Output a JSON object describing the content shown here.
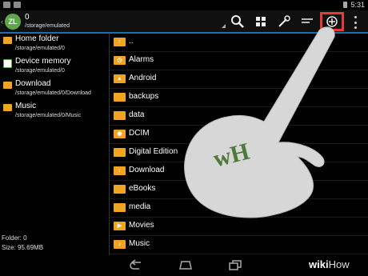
{
  "status_bar": {
    "time": "5:31"
  },
  "action_bar": {
    "app_logo_text": "ZL",
    "current_folder": "0",
    "current_path": "/storage/emulated",
    "icons": [
      "search-icon",
      "grid-view-icon",
      "tools-icon",
      "sort-icon",
      "add-icon",
      "overflow-menu-icon"
    ]
  },
  "sidebar": {
    "items": [
      {
        "label": "Home folder",
        "path": "/storage/emulated/0",
        "icon": "home-folder-icon"
      },
      {
        "label": "Device memory",
        "path": "/storage/emulated/0",
        "icon": "device-memory-icon"
      },
      {
        "label": "Download",
        "path": "/storage/emulated/0/Download",
        "icon": "folder-icon"
      },
      {
        "label": "Music",
        "path": "/storage/emulated/0/Music",
        "icon": "folder-icon"
      }
    ],
    "footer_folder": "Folder: 0",
    "footer_size": "Size: 95.69MB"
  },
  "files": [
    {
      "name": "..",
      "icon": "up-folder-icon"
    },
    {
      "name": "Alarms",
      "icon": "alarm-folder-icon"
    },
    {
      "name": "Android",
      "icon": "android-folder-icon"
    },
    {
      "name": "backups",
      "icon": "folder-icon"
    },
    {
      "name": "data",
      "icon": "folder-icon"
    },
    {
      "name": "DCIM",
      "icon": "camera-folder-icon"
    },
    {
      "name": "Digital Edition",
      "icon": "folder-icon"
    },
    {
      "name": "Download",
      "icon": "download-folder-icon"
    },
    {
      "name": "eBooks",
      "icon": "folder-icon"
    },
    {
      "name": "media",
      "icon": "folder-icon"
    },
    {
      "name": "Movies",
      "icon": "movies-folder-icon"
    },
    {
      "name": "Music",
      "icon": "music-folder-icon"
    }
  ],
  "watermark": {
    "logo_text": "wH",
    "brand_wiki": "wiki",
    "brand_how": "How"
  },
  "colors": {
    "accent": "#1f6fa6",
    "folder": "#f0a422",
    "highlight": "#e43a3a",
    "logo_green": "#5fa64a"
  }
}
